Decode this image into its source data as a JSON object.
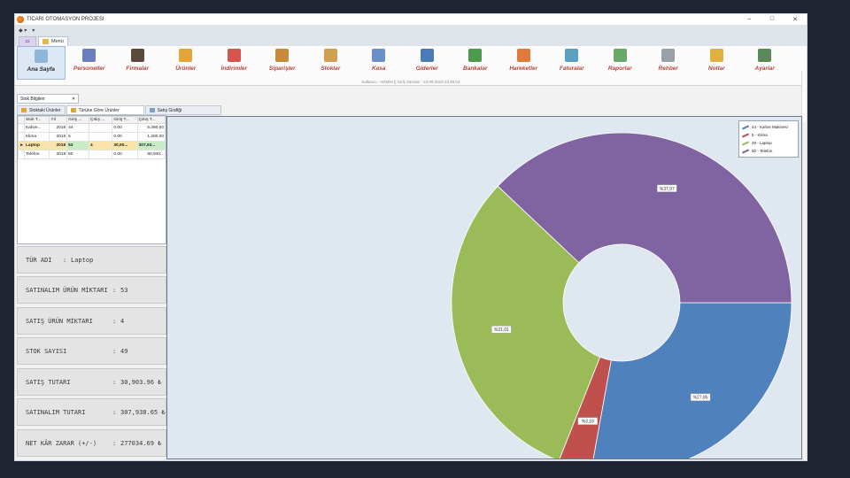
{
  "window": {
    "title": "TICARI OTOMASYON PROJESI",
    "min_label": "–",
    "max_label": "□",
    "close_label": "✕"
  },
  "qat": {
    "item1": "◆ ▾",
    "item2": "▾"
  },
  "ribbon_tabs": [
    {
      "label": ""
    },
    {
      "label": "Menü"
    }
  ],
  "ribbon_buttons": [
    {
      "label": "Ana Sayfa",
      "icon": "home-icon",
      "color": "#8fb6d9"
    },
    {
      "label": "Personeller",
      "icon": "person-icon",
      "color": "#6b7fc0"
    },
    {
      "label": "Firmalar",
      "icon": "businessman-icon",
      "color": "#5a4a3a"
    },
    {
      "label": "Ürünler",
      "icon": "box-icon",
      "color": "#e3a53a"
    },
    {
      "label": "İndirimler",
      "icon": "bar-chart-icon",
      "color": "#d9534f"
    },
    {
      "label": "Siparişler",
      "icon": "boxes-icon",
      "color": "#c98a3a"
    },
    {
      "label": "Stoklar",
      "icon": "documents-icon",
      "color": "#d0a050"
    },
    {
      "label": "Kasa",
      "icon": "list-icon",
      "color": "#6c8fc8"
    },
    {
      "label": "Giderler",
      "icon": "tag-icon",
      "color": "#4a7ab8"
    },
    {
      "label": "Bankalar",
      "icon": "book-icon",
      "color": "#4c9a4c"
    },
    {
      "label": "Hareketler",
      "icon": "chart-arrow-icon",
      "color": "#e07a3a"
    },
    {
      "label": "Faturalar",
      "icon": "calendar-icon",
      "color": "#5aa0c0"
    },
    {
      "label": "Raporlar",
      "icon": "report-icon",
      "color": "#6aa86a"
    },
    {
      "label": "Rehber",
      "icon": "address-book-icon",
      "color": "#9aa0a8"
    },
    {
      "label": "Notlar",
      "icon": "note-icon",
      "color": "#e0b040"
    },
    {
      "label": "Ayarlar",
      "icon": "settings-user-icon",
      "color": "#5a8a5a"
    }
  ],
  "user_info": "Kullanıcı : ADMİN   ||   Giriş Zamanı : 24.09.2018 23:46:03",
  "doc_tab": {
    "label": "Stok Bilgileri",
    "close": "✕"
  },
  "inner_tabs": [
    {
      "label": "Stoktaki Ürünler"
    },
    {
      "label": "Türüne Göre Ürünler"
    },
    {
      "label": "Satış Grafiği"
    }
  ],
  "grid": {
    "columns": [
      "Stok T...",
      "Yıl",
      "Giriş ...",
      "Çıkış ...",
      "Giriş T...",
      "Çıkış T..."
    ],
    "rows": [
      {
        "ind": "",
        "name": "Kahve...",
        "year": "2018",
        "in": "44",
        "out": "",
        "in_total": "0.00",
        "out_total": "5,280.00"
      },
      {
        "ind": "",
        "name": "Klima",
        "year": "2018",
        "in": "5",
        "out": "",
        "in_total": "0.00",
        "out_total": "1,200.00"
      },
      {
        "ind": "▸",
        "name": "Laptop",
        "year": "2018",
        "in": "53",
        "out": "4",
        "in_total": "30,90...",
        "out_total": "307,93..."
      },
      {
        "ind": "",
        "name": "Telefon",
        "year": "2018",
        "in": "60",
        "out": "",
        "in_total": "0.00",
        "out_total": "80,940..."
      }
    ]
  },
  "details": [
    {
      "label": "TÜR ADI",
      "sep": ":",
      "value": "Laptop"
    },
    {
      "label": "SATINALIM ÜRÜN MİKTARI",
      "sep": ":",
      "value": "53"
    },
    {
      "label": "SATIŞ ÜRÜN MİKTARI",
      "sep": ":",
      "value": "4"
    },
    {
      "label": "STOK SAYISI",
      "sep": ":",
      "value": "49"
    },
    {
      "label": "SATIŞ TUTARI",
      "sep": ":",
      "value": "30,903.96 ₺"
    },
    {
      "label": "SATINALIM TUTARI",
      "sep": ":",
      "value": "307,938.65 ₺"
    },
    {
      "label": "NET KÂR ZARAR (+/-)",
      "sep": ":",
      "value": "277034.69 ₺"
    }
  ],
  "chart_data": {
    "type": "pie",
    "subtype": "doughnut",
    "categories": [
      "44 - Kahve Makinesi",
      "5 - Klima",
      "49 - Laptop",
      "60 - Telefon"
    ],
    "values": [
      27.85,
      3.16,
      31.01,
      37.97
    ],
    "labels": [
      "%27,85",
      "%3,16",
      "%31,01",
      "%37,97"
    ],
    "colors": [
      "#4f81bd",
      "#c0504d",
      "#9bbb59",
      "#8064a2"
    ],
    "start_angle_deg": 0,
    "legend_position": "top-right"
  }
}
